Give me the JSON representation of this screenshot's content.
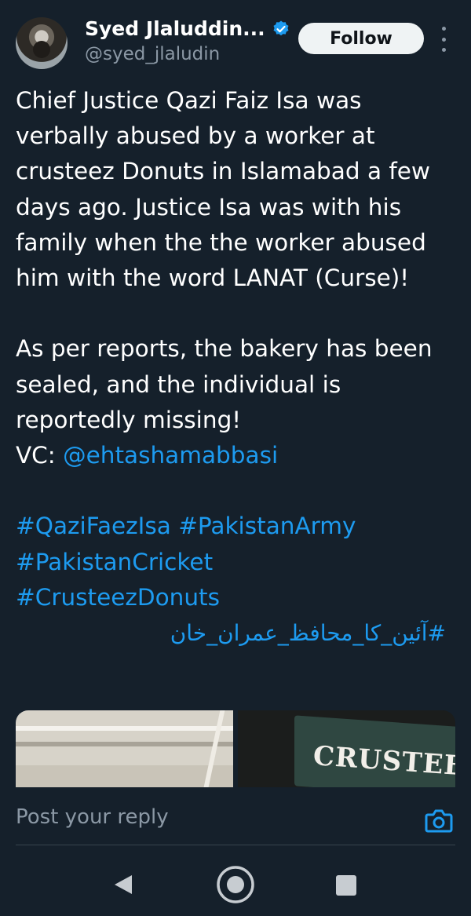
{
  "header": {
    "display_name": "Syed Jlaluddin...",
    "handle": "@syed_jlaludin",
    "follow_label": "Follow"
  },
  "tweet": {
    "paragraph1": "Chief Justice Qazi Faiz Isa was verbally abused by a worker at crusteez Donuts in Islamabad a few days ago. Justice Isa was with his family when the the worker abused him with the word LANAT (Curse)!",
    "paragraph2": "As per reports, the bakery has been sealed, and the individual is reportedly missing!",
    "vc_label": "VC: ",
    "vc_mention": "@ehtashamabbasi",
    "hashtags": {
      "tag1": "#QaziFaezIsa",
      "tag2": "#PakistanArmy",
      "tag3": "#PakistanCricket",
      "tag4": "#CrusteezDonuts",
      "tag5": "#آئین_کا_محافظ_عمران_خان"
    },
    "media_sign_text": "CRUSTEEZ"
  },
  "reply": {
    "placeholder": "Post your reply"
  },
  "colors": {
    "background": "#15202b",
    "link": "#1d9bf0",
    "muted": "#8b98a5",
    "verified": "#1d9bf0"
  },
  "icons": {
    "verified": "verified-badge-icon",
    "more": "more-vertical-icon",
    "camera": "camera-icon",
    "back": "triangle-back-icon",
    "home": "circle-home-icon",
    "recent": "square-recents-icon"
  }
}
